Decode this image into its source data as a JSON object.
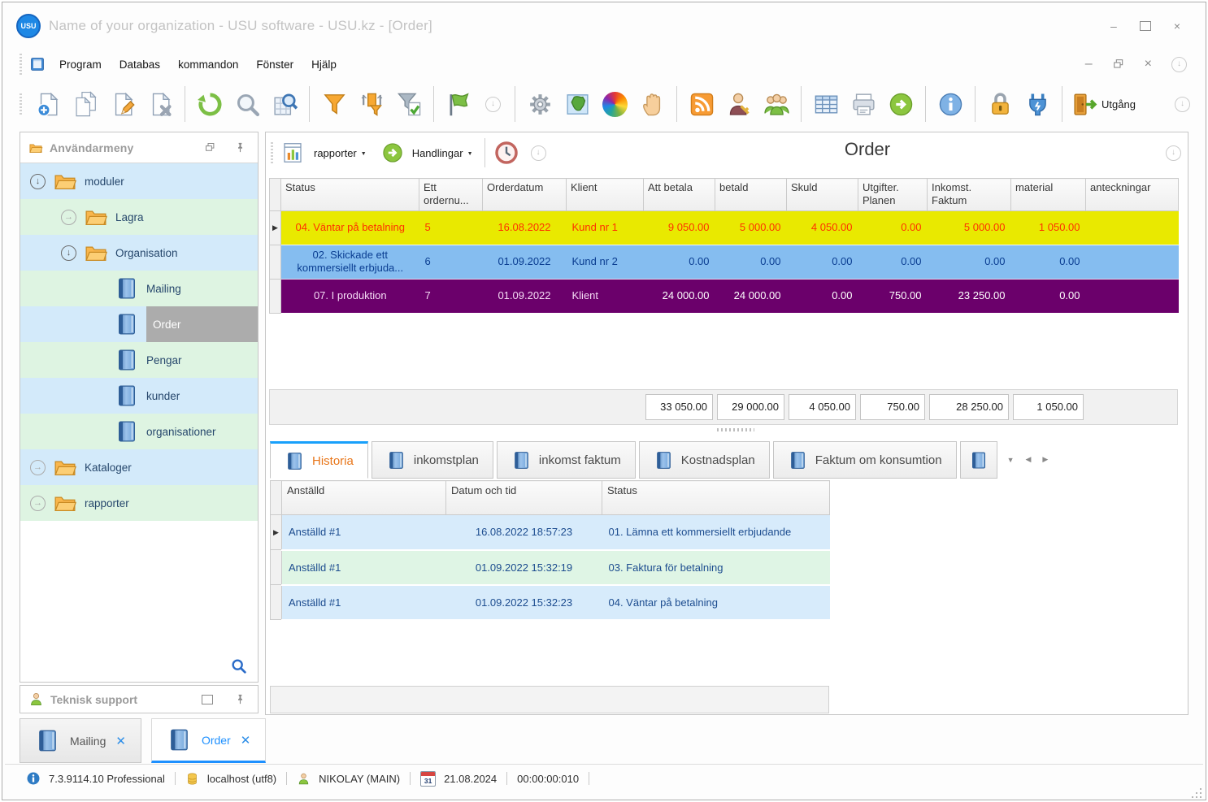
{
  "window": {
    "title": "Name of your organization - USU software - USU.kz - [Order]",
    "logo": "USU"
  },
  "menu": {
    "items": [
      "Program",
      "Databas",
      "kommandon",
      "Fönster",
      "Hjälp"
    ]
  },
  "toolbar": {
    "exit_label": "Utgång"
  },
  "sidebar": {
    "header": "Användarmeny",
    "support_title": "Teknisk support",
    "tree": [
      {
        "label": "moduler",
        "depth": 0,
        "icon": "folder",
        "expand": "open"
      },
      {
        "label": "Lagra",
        "depth": 1,
        "icon": "folder",
        "expand": "closed"
      },
      {
        "label": "Organisation",
        "depth": 1,
        "icon": "folder",
        "expand": "open"
      },
      {
        "label": "Mailing",
        "depth": 2,
        "icon": "book"
      },
      {
        "label": "Order",
        "depth": 2,
        "icon": "book",
        "selected": true
      },
      {
        "label": "Pengar",
        "depth": 2,
        "icon": "book"
      },
      {
        "label": "kunder",
        "depth": 2,
        "icon": "book"
      },
      {
        "label": "organisationer",
        "depth": 2,
        "icon": "book"
      },
      {
        "label": "Kataloger",
        "depth": 0,
        "icon": "folder",
        "expand": "closed"
      },
      {
        "label": "rapporter",
        "depth": 0,
        "icon": "folder",
        "expand": "closed"
      }
    ]
  },
  "panel": {
    "toolbar": {
      "reports_label": "rapporter",
      "actions_label": "Handlingar"
    },
    "title": "Order",
    "grid": {
      "columns": [
        "Status",
        "Ett ordernu...",
        "Orderdatum",
        "Klient",
        "Att betala",
        "betald",
        "Skuld",
        "Utgifter. Planen",
        "Inkomst. Faktum",
        "material",
        "anteckningar"
      ],
      "rows": [
        {
          "color": "yellow",
          "cells": [
            "04. Väntar på betalning",
            "5",
            "16.08.2022",
            "Kund nr 1",
            "9 050.00",
            "5 000.00",
            "4 050.00",
            "0.00",
            "5 000.00",
            "1 050.00",
            ""
          ]
        },
        {
          "color": "blue",
          "cells": [
            "02. Skickade ett kommersiellt erbjuda...",
            "6",
            "01.09.2022",
            "Kund nr 2",
            "0.00",
            "0.00",
            "0.00",
            "0.00",
            "0.00",
            "0.00",
            ""
          ]
        },
        {
          "color": "purple",
          "cells": [
            "07. I produktion",
            "7",
            "01.09.2022",
            "Klient",
            "24 000.00",
            "24 000.00",
            "0.00",
            "750.00",
            "23 250.00",
            "0.00",
            ""
          ]
        }
      ],
      "totals": [
        "33 050.00",
        "29 000.00",
        "4 050.00",
        "750.00",
        "28 250.00",
        "1 050.00"
      ]
    },
    "tabs": [
      "Historia",
      "inkomstplan",
      "inkomst faktum",
      "Kostnadsplan",
      "Faktum om konsumtion"
    ],
    "active_tab": "Historia",
    "history": {
      "columns": [
        "Anställd",
        "Datum och tid",
        "Status"
      ],
      "rows": [
        [
          "Anställd #1",
          "16.08.2022 18:57:23",
          "01. Lämna ett kommersiellt erbjudande"
        ],
        [
          "Anställd #1",
          "01.09.2022 15:32:19",
          "03. Faktura för betalning"
        ],
        [
          "Anställd #1",
          "01.09.2022 15:32:23",
          "04. Väntar på betalning"
        ]
      ]
    }
  },
  "doc_tabs": [
    {
      "label": "Mailing",
      "active": false
    },
    {
      "label": "Order",
      "active": true
    }
  ],
  "statusbar": {
    "version": "7.3.9114.10 Professional",
    "db": "localhost (utf8)",
    "user": "NIKOLAY (MAIN)",
    "calendar_day": "31",
    "date": "21.08.2024",
    "timer": "00:00:00:010"
  },
  "colors": {
    "accent": "#1E90FF",
    "row_yellow": "#E9E900",
    "row_yellow_text": "#FF3000",
    "row_blue": "#85BDF0",
    "row_blue_text": "#0A3D91",
    "row_purple": "#6B006B",
    "active_tab_text": "#E8761A",
    "tree_blue": "#D3EAFA",
    "tree_green": "#DEF4E2"
  }
}
